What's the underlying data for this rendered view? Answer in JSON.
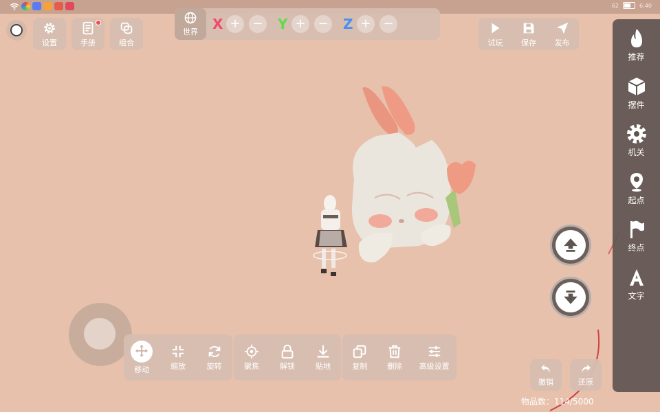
{
  "colors": {
    "background": "#e7c1ac",
    "axis_x": "#f04a6a",
    "axis_y": "#5fdc4a",
    "axis_z": "#4a90f0",
    "sidebar": "#5f5450"
  },
  "status_bar": {
    "battery": "62",
    "time": "6:40"
  },
  "top_left": {
    "settings_label": "设置",
    "manual_label": "手册",
    "group_label": "组合"
  },
  "axis_toolbar": {
    "world_label": "世界",
    "x_label": "X",
    "y_label": "Y",
    "z_label": "Z",
    "plus": "+",
    "minus": "−"
  },
  "top_right": {
    "try_label": "试玩",
    "save_label": "保存",
    "publish_label": "发布"
  },
  "sidebar": {
    "items": [
      {
        "label": "推荐",
        "icon": "flame-icon"
      },
      {
        "label": "摆件",
        "icon": "cube-icon"
      },
      {
        "label": "机关",
        "icon": "gear-icon"
      },
      {
        "label": "起点",
        "icon": "pin-icon"
      },
      {
        "label": "终点",
        "icon": "flag-icon"
      },
      {
        "label": "文字",
        "icon": "text-icon"
      }
    ]
  },
  "bottom_toolbar": {
    "move_label": "移动",
    "scale_label": "缩放",
    "rotate_label": "旋转",
    "focus_label": "聚焦",
    "unlock_label": "解锁",
    "ground_label": "贴地",
    "copy_label": "复制",
    "delete_label": "删除",
    "advanced_label": "高级设置"
  },
  "history": {
    "undo_label": "撤销",
    "redo_label": "还原"
  },
  "item_count": {
    "text": "物品数：114/5000"
  }
}
